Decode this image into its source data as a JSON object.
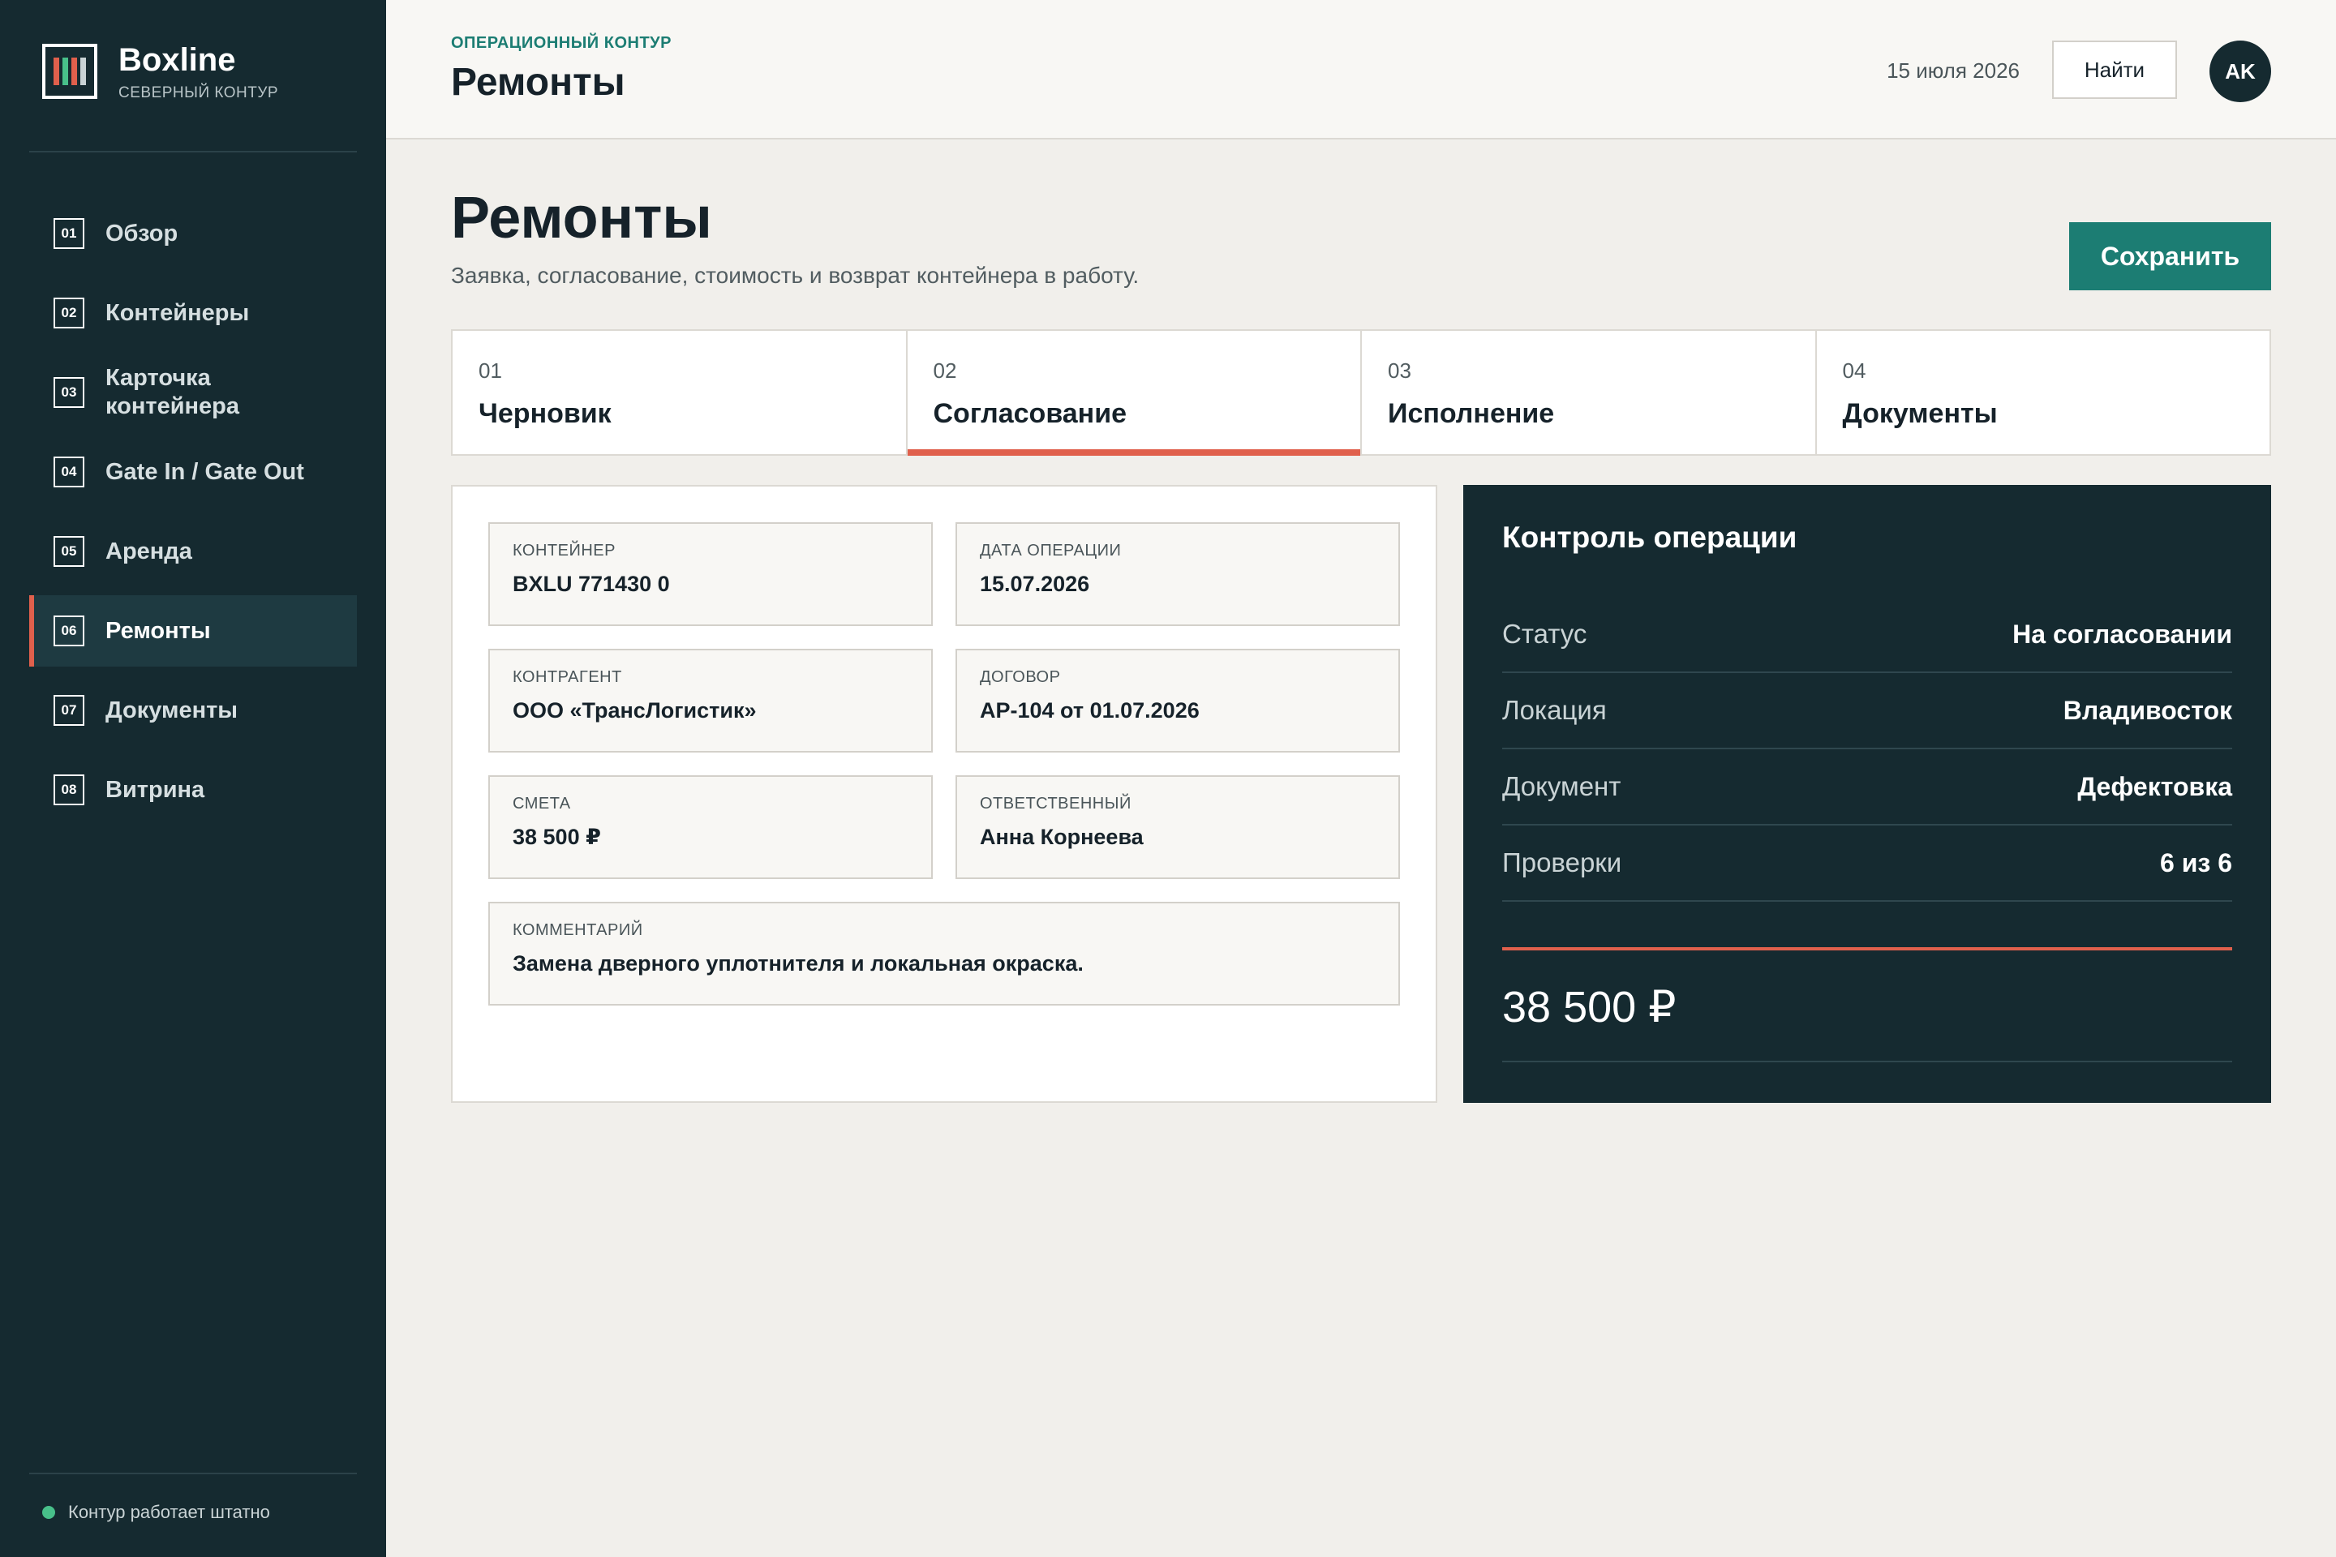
{
  "brand": {
    "name": "Boxline",
    "subtitle": "СЕВЕРНЫЙ КОНТУР",
    "logo_colors": [
      "#e0604c",
      "#48c08a",
      "#e0604c",
      "#c9d3d5"
    ]
  },
  "sidebar": {
    "items": [
      {
        "num": "01",
        "label": "Обзор",
        "active": false
      },
      {
        "num": "02",
        "label": "Контейнеры",
        "active": false
      },
      {
        "num": "03",
        "label": "Карточка контейнера",
        "active": false
      },
      {
        "num": "04",
        "label": "Gate In / Gate Out",
        "active": false
      },
      {
        "num": "05",
        "label": "Аренда",
        "active": false
      },
      {
        "num": "06",
        "label": "Ремонты",
        "active": true
      },
      {
        "num": "07",
        "label": "Документы",
        "active": false
      },
      {
        "num": "08",
        "label": "Витрина",
        "active": false
      }
    ],
    "status_text": "Контур работает штатно",
    "status_color": "#48c08a"
  },
  "header": {
    "eyebrow": "ОПЕРАЦИОННЫЙ КОНТУР",
    "title": "Ремонты",
    "date": "15 июля 2026",
    "find_label": "Найти",
    "avatar_initials": "AK"
  },
  "main": {
    "title": "Ремонты",
    "subtitle": "Заявка, согласование, стоимость и возврат контейнера в работу.",
    "save_label": "Сохранить",
    "steps": [
      {
        "num": "01",
        "label": "Черновик",
        "active": false
      },
      {
        "num": "02",
        "label": "Согласование",
        "active": true
      },
      {
        "num": "03",
        "label": "Исполнение",
        "active": false
      },
      {
        "num": "04",
        "label": "Документы",
        "active": false
      }
    ],
    "form": {
      "container": {
        "label": "Контейнер",
        "value": "BXLU 771430 0"
      },
      "op_date": {
        "label": "Дата операции",
        "value": "15.07.2026"
      },
      "counterparty": {
        "label": "Контрагент",
        "value": "ООО «ТрансЛогистик»"
      },
      "contract": {
        "label": "Договор",
        "value": "AP-104 от 01.07.2026"
      },
      "estimate": {
        "label": "Смета",
        "value": "38 500 ₽"
      },
      "responsible": {
        "label": "Ответственный",
        "value": "Анна Корнеева"
      },
      "comment": {
        "label": "Комментарий",
        "value": "Замена дверного уплотнителя и локальная окраска."
      }
    },
    "control": {
      "title": "Контроль операции",
      "rows": [
        {
          "key": "Статус",
          "value": "На согласовании"
        },
        {
          "key": "Локация",
          "value": "Владивосток"
        },
        {
          "key": "Документ",
          "value": "Дефектовка"
        },
        {
          "key": "Проверки",
          "value": "6 из 6"
        }
      ],
      "total": "38 500 ₽"
    }
  },
  "colors": {
    "accent": "#1c7d73",
    "highlight": "#e0604c",
    "sidebar_bg": "#152a30"
  }
}
